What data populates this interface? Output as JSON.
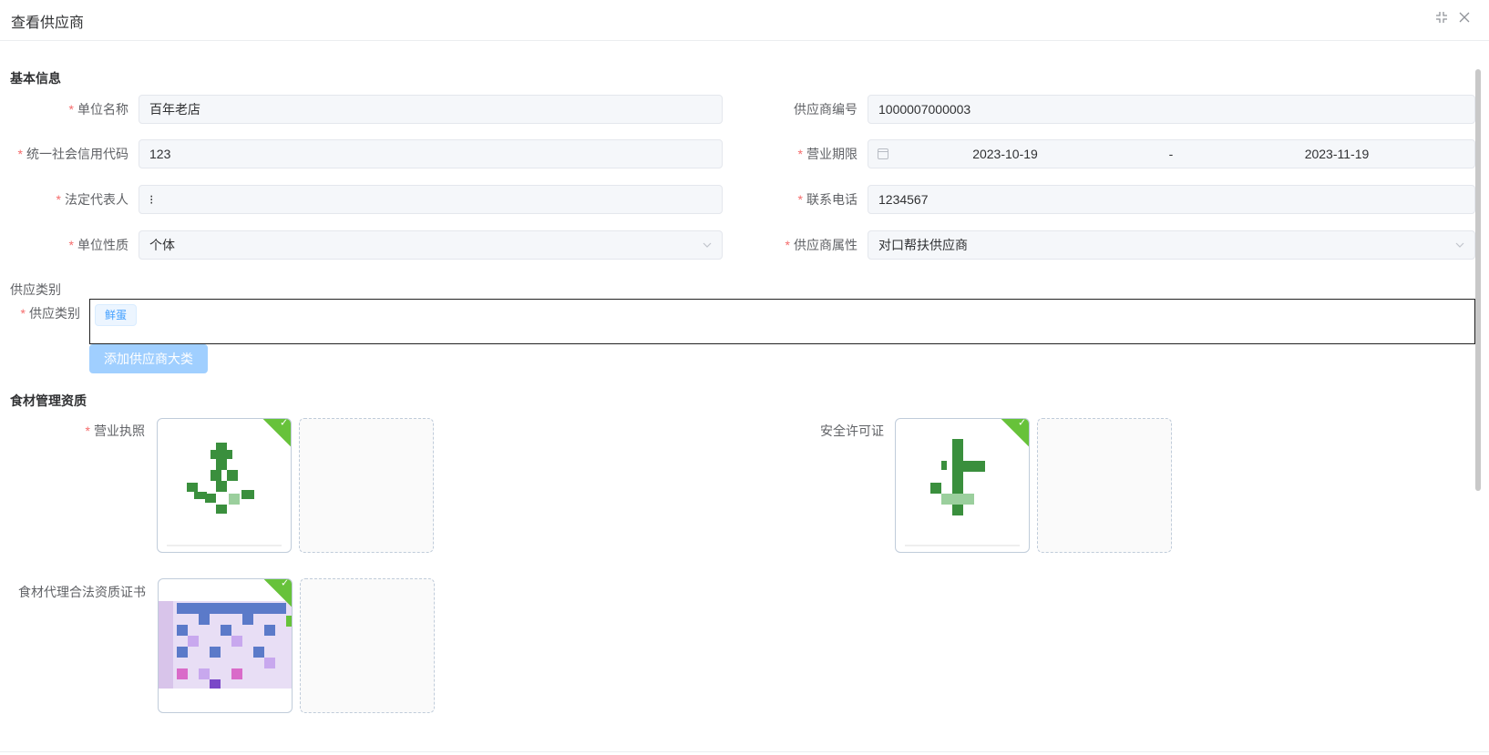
{
  "header": {
    "title": "查看供应商",
    "collapse_icon": "collapse-icon",
    "close_icon": "close-icon"
  },
  "sections": {
    "basic": "基本信息",
    "supply_category": "供应类别",
    "qualification": "食材管理资质"
  },
  "form": {
    "unit_name": {
      "label": "单位名称",
      "value": "百年老店"
    },
    "supplier_no": {
      "label": "供应商编号",
      "value": "1000007000003"
    },
    "credit_code": {
      "label": "统一社会信用代码",
      "value": "123"
    },
    "business_term": {
      "label": "营业期限",
      "start": "2023-10-19",
      "sep": "-",
      "end": "2023-11-19"
    },
    "legal_rep": {
      "label": "法定代表人",
      "value": "⁝"
    },
    "phone": {
      "label": "联系电话",
      "value": "1234567"
    },
    "unit_nature": {
      "label": "单位性质",
      "value": "个体"
    },
    "supplier_attr": {
      "label": "供应商属性",
      "value": "对口帮扶供应商"
    },
    "category": {
      "label": "供应类别",
      "tags": [
        "鲜蛋"
      ],
      "add_button": "添加供应商大类"
    }
  },
  "qualifications": {
    "license": {
      "label": "营业执照"
    },
    "safety": {
      "label": "安全许可证"
    },
    "agency": {
      "label": "食材代理合法资质证书"
    }
  },
  "colors": {
    "required": "#f56c6c",
    "primary": "#409eff",
    "success": "#67c23a"
  }
}
